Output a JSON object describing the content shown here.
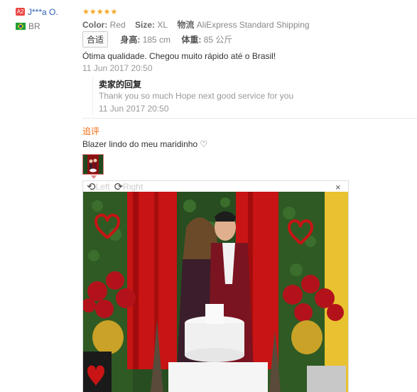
{
  "user": {
    "badge": "A2",
    "name": "J***a O.",
    "country": "BR"
  },
  "rating": {
    "stars": "★★★★★"
  },
  "meta": {
    "color_label": "Color:",
    "color_value": "Red",
    "size_label": "Size:",
    "size_value": "XL",
    "logistics_label": "物流",
    "logistics_value": "AliExpress Standard Shipping"
  },
  "fit": {
    "tag": "合适",
    "height_label": "身高:",
    "height_value": "185 cm",
    "weight_label": "体重:",
    "weight_value": "85 公斤"
  },
  "review": {
    "text": "Ótima qualidade. Chegou muito rápido até o Brasil!",
    "date": "11 Jun 2017 20:50"
  },
  "seller_reply": {
    "title": "卖家的回复",
    "text": "Thank you so much Hope next good service for you",
    "date": "11 Jun 2017 20:50"
  },
  "followup": {
    "title": "追评",
    "text": "Blazer lindo do meu maridinho ♡"
  },
  "viewer": {
    "rotate_left": "Left",
    "rotate_right": "Right",
    "close": "×"
  },
  "colors": {
    "link": "#2a5db0",
    "star": "#f5a623",
    "accent": "#f26a10"
  }
}
